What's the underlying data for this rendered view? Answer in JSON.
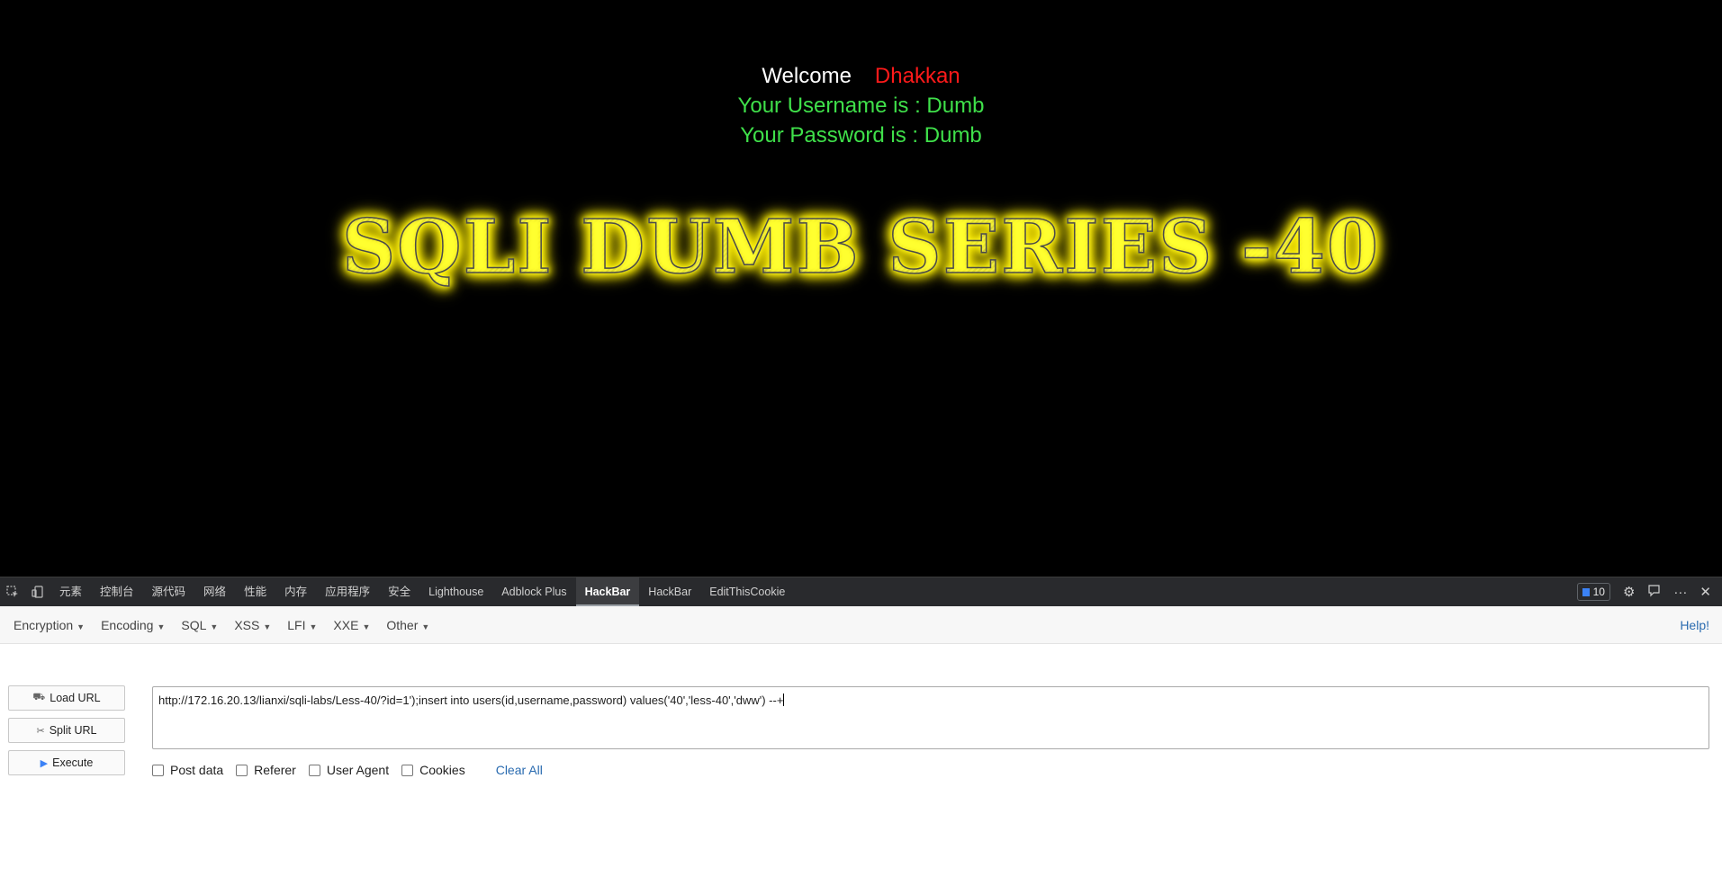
{
  "page": {
    "welcome": "Welcome",
    "user_name": "Dhakkan",
    "username_line": "Your Username is : Dumb",
    "password_line": "Your Password is : Dumb",
    "banner": "SQLI DUMB SERIES -40"
  },
  "devtools": {
    "tabs": [
      "元素",
      "控制台",
      "源代码",
      "网络",
      "性能",
      "内存",
      "应用程序",
      "安全",
      "Lighthouse",
      "Adblock Plus",
      "HackBar",
      "HackBar",
      "EditThisCookie"
    ],
    "active_tab": "HackBar",
    "issues_count": "10"
  },
  "hackbar": {
    "menus": [
      "Encryption",
      "Encoding",
      "SQL",
      "XSS",
      "LFI",
      "XXE",
      "Other"
    ],
    "help": "Help!",
    "buttons": {
      "load": "Load URL",
      "split": "Split URL",
      "execute": "Execute"
    },
    "url_value": "http://172.16.20.13/lianxi/sqli-labs/Less-40/?id=1');insert into users(id,username,password) values('40','less-40','dww') --+",
    "options": {
      "post_data": "Post data",
      "referer": "Referer",
      "user_agent": "User Agent",
      "cookies": "Cookies",
      "clear_all": "Clear All"
    }
  },
  "colors": {
    "welcome_name": "#ff1a1a",
    "green_text": "#3fe04a",
    "banner_glow": "#ffef00",
    "link": "#2a6bb0"
  }
}
